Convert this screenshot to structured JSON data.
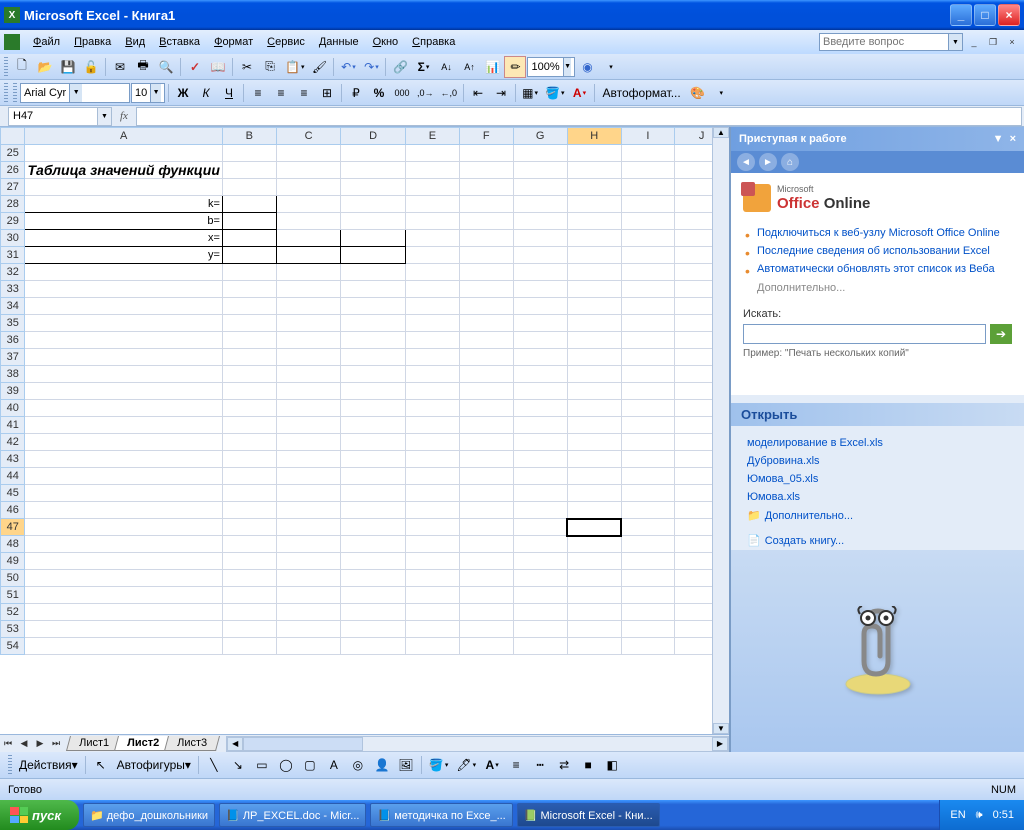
{
  "title": "Microsoft Excel - Книга1",
  "menus": [
    "Файл",
    "Правка",
    "Вид",
    "Вставка",
    "Формат",
    "Сервис",
    "Данные",
    "Окно",
    "Справка"
  ],
  "help_placeholder": "Введите вопрос",
  "font": {
    "name": "Arial Cyr",
    "size": "10"
  },
  "zoom": "100%",
  "autoformat_label": "Автоформат...",
  "namebox": "H47",
  "columns": [
    "A",
    "B",
    "C",
    "D",
    "E",
    "F",
    "G",
    "H",
    "I",
    "J"
  ],
  "row_start": 25,
  "row_end": 54,
  "active_col": "H",
  "active_row": 47,
  "cells": {
    "26": {
      "A": {
        "text": "Таблица значений функции",
        "cls": "title-cell"
      }
    },
    "28": {
      "A": {
        "text": "k=",
        "cls": "tbl-border rt"
      },
      "B": {
        "text": "",
        "cls": "tbl-border"
      }
    },
    "29": {
      "A": {
        "text": "b=",
        "cls": "tbl-border rt"
      },
      "B": {
        "text": "",
        "cls": "tbl-border"
      }
    },
    "30": {
      "A": {
        "text": "x=",
        "cls": "tbl-border rt"
      },
      "B": {
        "text": "",
        "cls": "tbl-border"
      },
      "C": {
        "text": "",
        "cls": "tbl-border"
      },
      "D": {
        "text": "",
        "cls": "tbl-border"
      }
    },
    "31": {
      "A": {
        "text": "y=",
        "cls": "tbl-border rt"
      },
      "B": {
        "text": "",
        "cls": "tbl-border"
      },
      "C": {
        "text": "",
        "cls": "tbl-border"
      },
      "D": {
        "text": "",
        "cls": "tbl-border"
      }
    }
  },
  "sheets": [
    "Лист1",
    "Лист2",
    "Лист3"
  ],
  "active_sheet": 1,
  "draw": {
    "actions": "Действия",
    "autoshapes": "Автофигуры"
  },
  "status": {
    "ready": "Готово",
    "num": "NUM"
  },
  "taskpane": {
    "title": "Приступая к работе",
    "office_brand_prefix": "Microsoft",
    "office_brand": "Office Online",
    "links": [
      "Подключиться к веб-узлу Microsoft Office Online",
      "Последние сведения об использовании Excel",
      "Автоматически обновлять этот список из Веба"
    ],
    "more": "Дополнительно...",
    "search_label": "Искать:",
    "search_hint": "Пример: \"Печать нескольких копий\"",
    "open_label": "Открыть",
    "recent": [
      "моделирование в Excel.xls",
      "Дубровина.xls",
      "Юмова_05.xls",
      "Юмова.xls"
    ],
    "open_more": "Дополнительно...",
    "create": "Создать книгу..."
  },
  "taskbar": {
    "start": "пуск",
    "tasks": [
      {
        "label": "дефо_дошкольники",
        "kind": "folder"
      },
      {
        "label": "ЛР_EXCEL.doc - Micr...",
        "kind": "word"
      },
      {
        "label": "методичка по Exce_...",
        "kind": "word"
      },
      {
        "label": "Microsoft Excel - Кни...",
        "kind": "excel",
        "active": true
      }
    ],
    "lang": "EN",
    "time": "0:51"
  }
}
